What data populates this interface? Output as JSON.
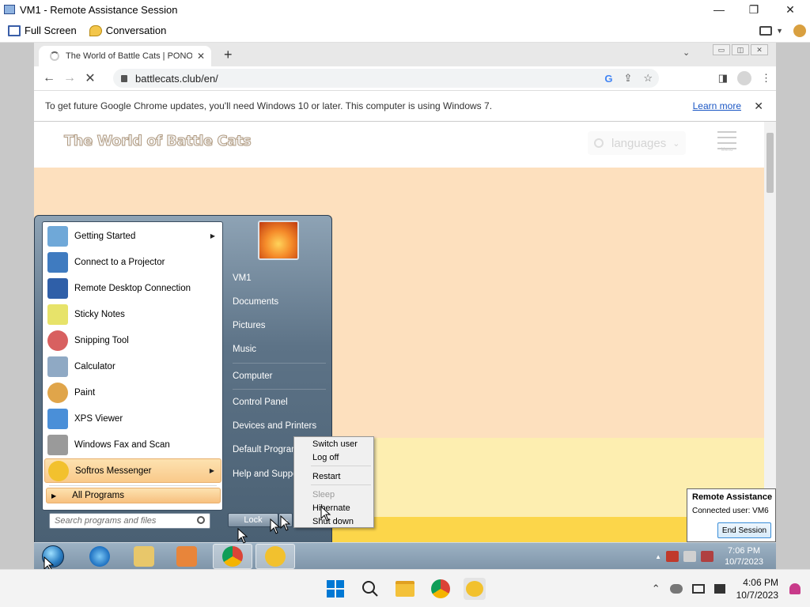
{
  "ra_window": {
    "title": "VM1 - Remote Assistance Session",
    "minimize": "—",
    "maximize": "❐",
    "close": "✕",
    "toolbar": {
      "full_screen": "Full Screen",
      "conversation": "Conversation"
    }
  },
  "chrome": {
    "tab_title": "The World of Battle Cats | PONOS",
    "tab_close": "✕",
    "new_tab": "+",
    "tab_search": "⌄",
    "window_controls": [
      "▭",
      "◫",
      "✕"
    ],
    "back": "←",
    "forward": "→",
    "reload": "✕",
    "url": "battlecats.club/en/",
    "omnibox_icons": [
      "G",
      "⇪",
      "☆"
    ],
    "right_icons": [
      "◨",
      "⋮"
    ],
    "infobar_text": "To get future Google Chrome updates, you'll need Windows 10 or later. This computer is using Windows 7.",
    "infobar_link": "Learn more",
    "infobar_close": "✕",
    "page": {
      "logo": "The World of Battle Cats",
      "language_button": "languages",
      "language_chevron": "⌄",
      "menu_label": "Menu"
    }
  },
  "start_menu": {
    "left_items": [
      {
        "label": "Getting Started",
        "icon": "getting-started-icon",
        "color": "#6fa8d8",
        "has_submenu": true
      },
      {
        "label": "Connect to a Projector",
        "icon": "projector-icon",
        "color": "#3f7bc0",
        "has_submenu": false
      },
      {
        "label": "Remote Desktop Connection",
        "icon": "remote-desktop-icon",
        "color": "#2f5fa8",
        "has_submenu": false
      },
      {
        "label": "Sticky Notes",
        "icon": "sticky-notes-icon",
        "color": "#e7e36a",
        "has_submenu": false
      },
      {
        "label": "Snipping Tool",
        "icon": "scissors-icon",
        "color": "#d86060",
        "has_submenu": false
      },
      {
        "label": "Calculator",
        "icon": "calculator-icon",
        "color": "#8fa9c4",
        "has_submenu": false
      },
      {
        "label": "Paint",
        "icon": "paint-icon",
        "color": "#e0a54a",
        "has_submenu": false
      },
      {
        "label": "XPS Viewer",
        "icon": "xps-viewer-icon",
        "color": "#4a8fd8",
        "has_submenu": false
      },
      {
        "label": "Windows Fax and Scan",
        "icon": "fax-icon",
        "color": "#9a9a9a",
        "has_submenu": false
      },
      {
        "label": "Softros Messenger",
        "icon": "messenger-icon",
        "color": "#f2c12e",
        "has_submenu": true
      }
    ],
    "all_programs": "All Programs",
    "all_programs_arrow": "▶",
    "submenu_arrow": "▶",
    "search_placeholder": "Search programs and files",
    "right_items": [
      "VM1",
      "Documents",
      "Pictures",
      "Music",
      "Computer",
      "Control Panel",
      "Devices and Printers",
      "Default Programs",
      "Help and Support"
    ],
    "lock_label": "Lock",
    "lock_arrow": "▶"
  },
  "power_menu": {
    "items": [
      {
        "label": "Switch user",
        "enabled": true
      },
      {
        "label": "Log off",
        "enabled": true
      },
      {
        "label": "Restart",
        "enabled": true
      },
      {
        "label": "Sleep",
        "enabled": false
      },
      {
        "label": "Hibernate",
        "enabled": true
      },
      {
        "label": "Shut down",
        "enabled": true
      }
    ]
  },
  "ra_popup": {
    "title": "Remote Assistance",
    "connected_user": "Connected user: VM6",
    "end_session": "End Session"
  },
  "w7_taskbar": {
    "tray_arrow": "▲",
    "time": "7:06 PM",
    "date": "10/7/2023"
  },
  "w11_taskbar": {
    "tray_chevron": "⌃",
    "time": "4:06 PM",
    "date": "10/7/2023"
  },
  "colors": {
    "start_menu_bg": "#5d7387",
    "page_bg": "#fde0be",
    "highlight": "#f9c98a",
    "w11_taskbar": "#f3f3f3"
  }
}
